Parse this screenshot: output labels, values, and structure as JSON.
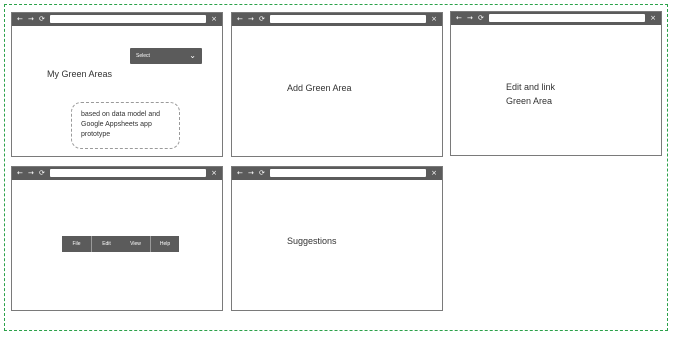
{
  "nav": {
    "back": "←",
    "forward": "→",
    "reload": "⟳",
    "close": "×"
  },
  "windows": {
    "my_green_areas": {
      "title": "My Green Areas",
      "select_label": "Select",
      "note": "based on data model and Google Appsheets app prototype"
    },
    "add_green_area": {
      "title": "Add Green Area"
    },
    "edit_link": {
      "line1": "Edit and link",
      "line2": "Green Area"
    },
    "menu_window": {
      "menu": [
        "File",
        "Edit",
        "View",
        "Help"
      ]
    },
    "suggestions": {
      "title": "Suggestions"
    }
  },
  "colors": {
    "frame": "#2ca24a",
    "bar": "#5b5b5b"
  }
}
